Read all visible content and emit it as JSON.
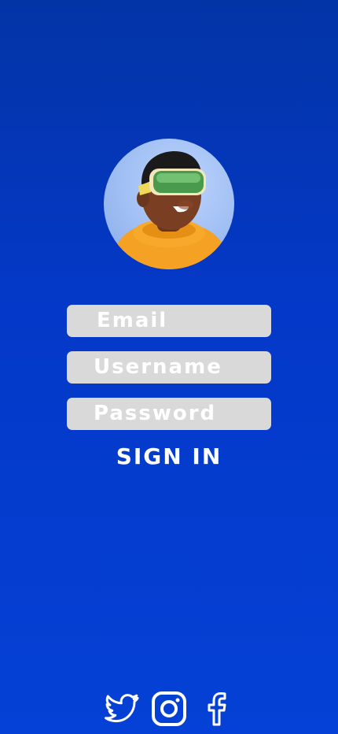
{
  "avatar": {
    "alt": "User avatar wearing VR headset"
  },
  "form": {
    "email_placeholder": "Email",
    "username_placeholder": "Username",
    "password_placeholder": "Password",
    "signin_label": "SIGN IN"
  },
  "social": {
    "icons": [
      "twitter-icon",
      "instagram-icon",
      "facebook-icon"
    ]
  },
  "colors": {
    "background_top": "#0334a6",
    "background_bottom": "#0541d6",
    "field_fill": "#d9d9d9",
    "text": "#ffffff"
  }
}
